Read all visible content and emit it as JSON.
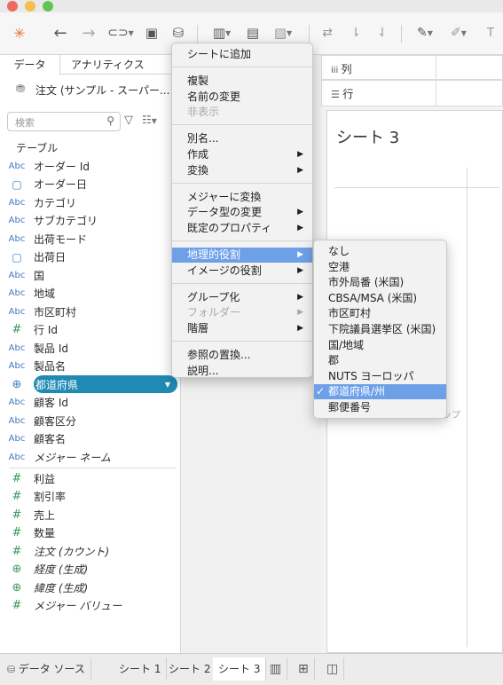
{
  "toolbar": {
    "icons": [
      "tableau-logo-icon",
      "back-icon",
      "forward-icon",
      "connect-icon",
      "save-icon",
      "new-datasource-icon",
      "new-sheet-icon",
      "duplicate-icon",
      "clear-icon",
      "swap-icon",
      "sort-asc-icon",
      "sort-desc-icon",
      "highlight-icon",
      "annotate-icon",
      "text-icon"
    ]
  },
  "left_panel": {
    "tabs": [
      "データ",
      "アナリティクス"
    ],
    "datasource": "注文 (サンプル - スーパー...",
    "search_placeholder": "検索",
    "section_title": "テーブル",
    "fields": [
      {
        "type": "Abc",
        "name": "オーダー Id"
      },
      {
        "type": "date",
        "name": "オーダー日"
      },
      {
        "type": "Abc",
        "name": "カテゴリ"
      },
      {
        "type": "Abc",
        "name": "サブカテゴリ"
      },
      {
        "type": "Abc",
        "name": "出荷モード"
      },
      {
        "type": "date",
        "name": "出荷日"
      },
      {
        "type": "Abc",
        "name": "国"
      },
      {
        "type": "Abc",
        "name": "地域"
      },
      {
        "type": "Abc",
        "name": "市区町村"
      },
      {
        "type": "#",
        "name": "行 Id"
      },
      {
        "type": "Abc",
        "name": "製品 Id"
      },
      {
        "type": "Abc",
        "name": "製品名"
      },
      {
        "type": "geo",
        "name": "都道府県",
        "selected": true
      },
      {
        "type": "Abc",
        "name": "顧客 Id"
      },
      {
        "type": "Abc",
        "name": "顧客区分"
      },
      {
        "type": "Abc",
        "name": "顧客名"
      },
      {
        "type": "Abc",
        "name": "メジャー ネーム",
        "italic": true
      }
    ],
    "measures": [
      {
        "type": "#",
        "name": "利益"
      },
      {
        "type": "#",
        "name": "割引率"
      },
      {
        "type": "#",
        "name": "売上"
      },
      {
        "type": "#",
        "name": "数量"
      },
      {
        "type": "#",
        "name": "注文 (カウント)",
        "italic": true
      },
      {
        "type": "geo",
        "name": "経度 (生成)",
        "italic": true
      },
      {
        "type": "geo",
        "name": "緯度 (生成)",
        "italic": true
      },
      {
        "type": "#",
        "name": "メジャー バリュー",
        "italic": true
      }
    ]
  },
  "shelves": {
    "columns_label": "列",
    "rows_label": "行"
  },
  "sheet": {
    "title": "シート 3",
    "partial_text": "ップ"
  },
  "context_menu": {
    "items": [
      {
        "label": "シートに追加"
      },
      {
        "sep": true
      },
      {
        "label": "複製"
      },
      {
        "label": "名前の変更"
      },
      {
        "label": "非表示",
        "disabled": true
      },
      {
        "sep": true
      },
      {
        "label": "別名..."
      },
      {
        "label": "作成",
        "submenu": true
      },
      {
        "label": "変換",
        "submenu": true
      },
      {
        "sep": true
      },
      {
        "label": "メジャーに変換"
      },
      {
        "label": "データ型の変更",
        "submenu": true
      },
      {
        "label": "既定のプロパティ",
        "submenu": true
      },
      {
        "sep": true
      },
      {
        "label": "地理的役割",
        "submenu": true,
        "highlighted": true
      },
      {
        "label": "イメージの役割",
        "submenu": true
      },
      {
        "sep": true
      },
      {
        "label": "グループ化",
        "submenu": true
      },
      {
        "label": "フォルダー",
        "submenu": true,
        "disabled": true
      },
      {
        "label": "階層",
        "submenu": true
      },
      {
        "sep": true
      },
      {
        "label": "参照の置換..."
      },
      {
        "label": "説明..."
      }
    ]
  },
  "geo_submenu": {
    "items": [
      {
        "label": "なし"
      },
      {
        "label": "空港"
      },
      {
        "label": "市外局番 (米国)"
      },
      {
        "label": "CBSA/MSA (米国)"
      },
      {
        "label": "市区町村"
      },
      {
        "label": "下院議員選挙区 (米国)"
      },
      {
        "label": "国/地域"
      },
      {
        "label": "郡"
      },
      {
        "label": "NUTS ヨーロッパ"
      },
      {
        "label": "都道府県/州",
        "checked": true,
        "highlighted": true
      },
      {
        "label": "郵便番号"
      }
    ]
  },
  "bottom_tabs": {
    "datasource": "データ ソース",
    "sheets": [
      "シート 1",
      "シート 2",
      "シート 3"
    ],
    "active_sheet": "シート 3"
  },
  "colors": {
    "highlight": "#6ea0e8",
    "selected_pill": "#1f8ab3",
    "dimension_icon": "#3f7cbf",
    "measure_icon": "#3a9a5b"
  }
}
